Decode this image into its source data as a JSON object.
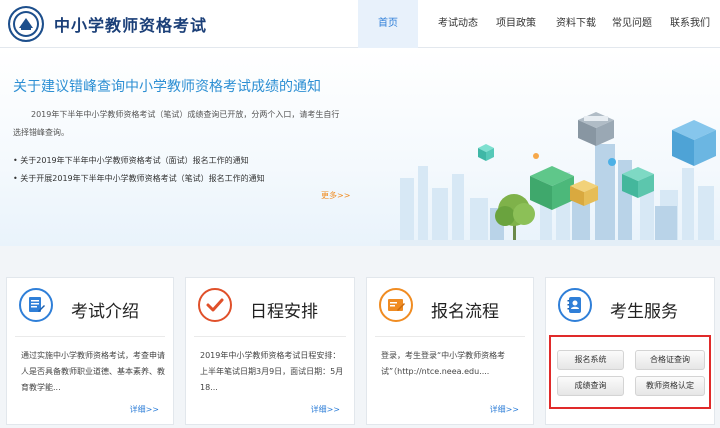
{
  "header": {
    "site_title": "中小学教师资格考试",
    "nav": [
      {
        "label": "首页",
        "active": true
      },
      {
        "label": "考试动态",
        "active": false
      },
      {
        "label": "项目政策",
        "active": false
      },
      {
        "label": "资料下载",
        "active": false
      },
      {
        "label": "常见问题",
        "active": false
      },
      {
        "label": "联系我们",
        "active": false
      }
    ]
  },
  "banner": {
    "title": "关于建议错峰查询中小学教师资格考试成绩的通知",
    "text": "2019年下半年中小学教师资格考试（笔试）成绩查询已开放，分两个入口，请考生自行选择错峰查询。",
    "links": [
      "关于2019年下半年中小学教师资格考试（面试）报名工作的通知",
      "关于开展2019年下半年中小学教师资格考试（笔试）报名工作的通知"
    ],
    "more": "更多>>"
  },
  "cards": [
    {
      "title": "考试介绍",
      "icon": "document-icon",
      "color": "#2f7fd8",
      "body": "通过实施中小学教师资格考试，考查申请人是否具备教师职业道德、基本素养、教育教学能...",
      "more": "详细>>"
    },
    {
      "title": "日程安排",
      "icon": "checkmark-icon",
      "color": "#e0502a",
      "body": "2019年中小学教师资格考试日程安排：上半年笔试日期3月9日，面试日期：5月18...",
      "more": "详细>>"
    },
    {
      "title": "报名流程",
      "icon": "registration-icon",
      "color": "#f08c22",
      "body": "登录，考生登录“中小学教师资格考试”（http://ntce.neea.edu....",
      "more": "详细>>"
    },
    {
      "title": "考生服务",
      "icon": "contacts-icon",
      "color": "#2f7fd8"
    }
  ],
  "service_buttons": [
    "报名系统",
    "合格证查询",
    "成绩查询",
    "教师资格认定"
  ],
  "colors": {
    "brand": "#1b3f78",
    "accent": "#2f7fd8",
    "highlight": "#e02a2a",
    "more_orange": "#f08c22"
  }
}
